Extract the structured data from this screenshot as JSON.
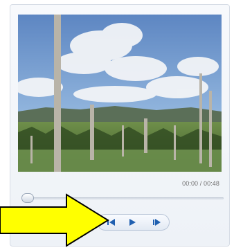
{
  "player": {
    "time_display": "00:00 / 00:48",
    "progress": 0.0
  },
  "controls": {
    "prev_icon": "previous-frame-icon",
    "play_icon": "play-icon",
    "next_icon": "next-frame-icon"
  },
  "colors": {
    "arrow_fill": "#ffff00",
    "arrow_stroke": "#000000",
    "control_blue": "#1f5fb0"
  }
}
